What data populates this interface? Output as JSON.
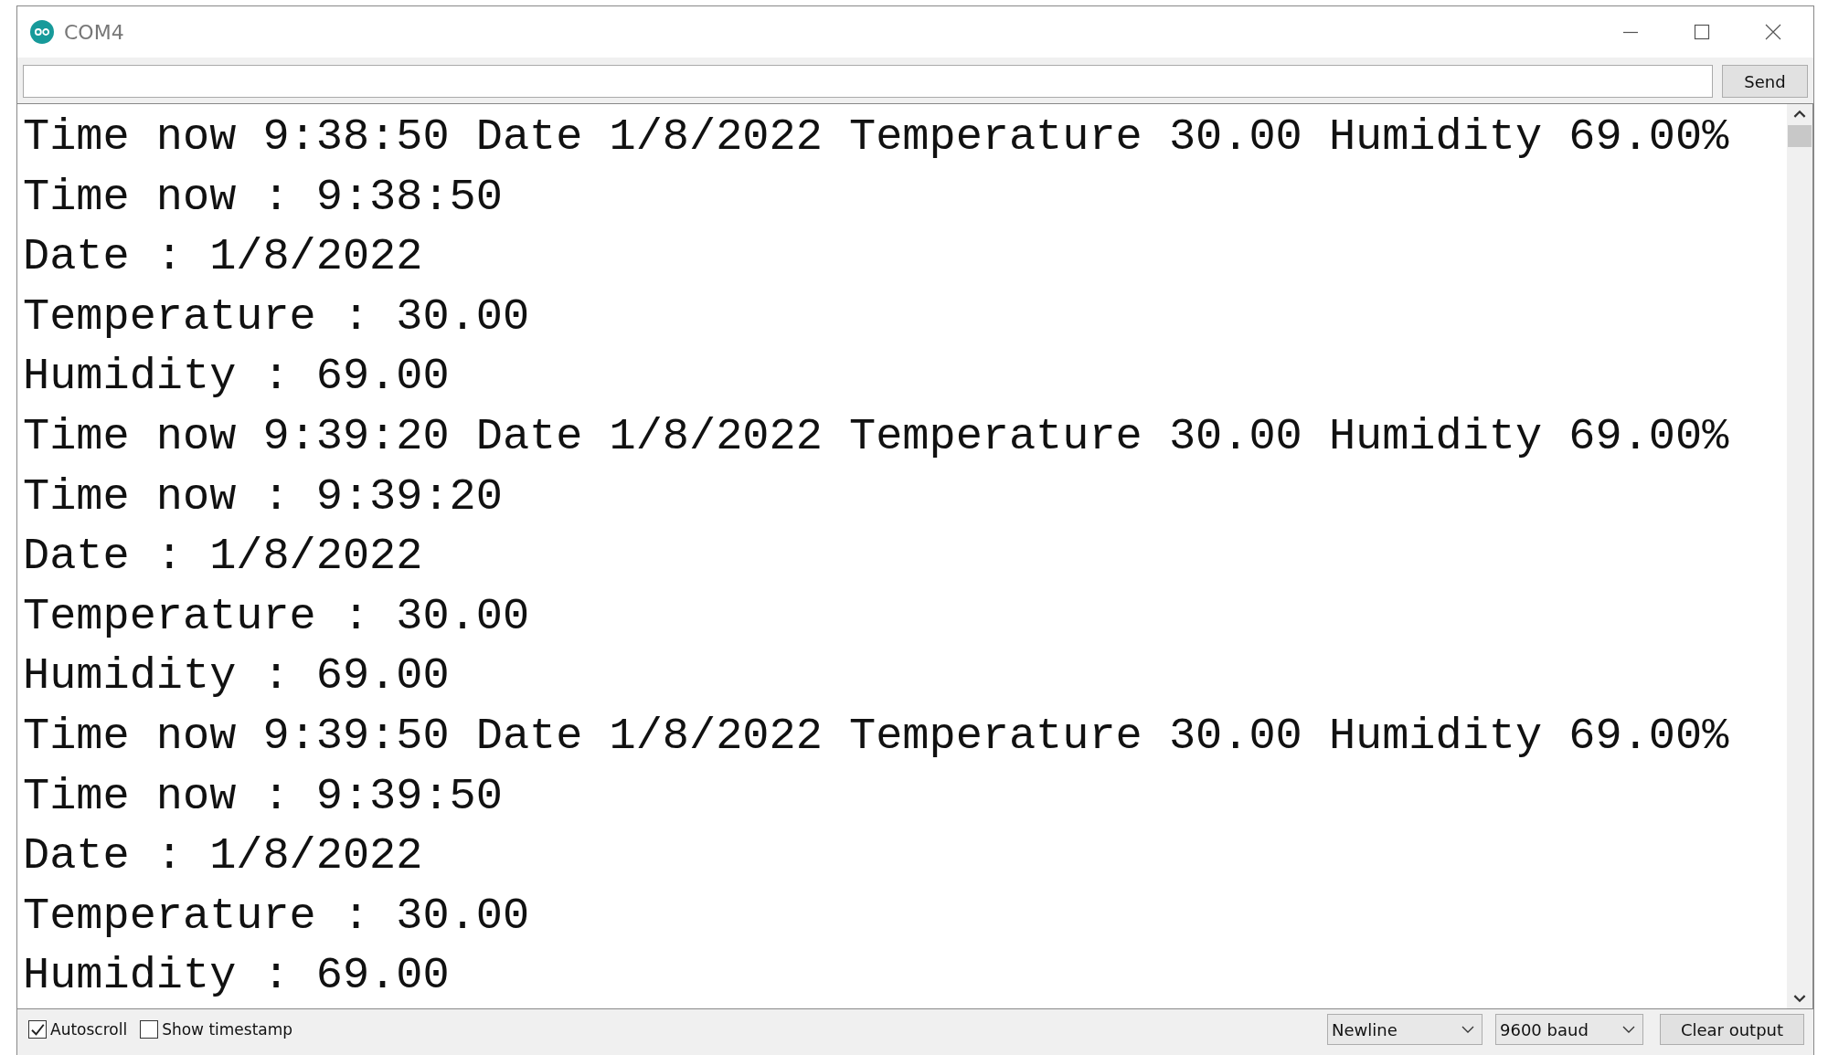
{
  "window": {
    "title": "COM4"
  },
  "input": {
    "button": "Send"
  },
  "output": {
    "lines": [
      "Time now 9:38:50 Date 1/8/2022 Temperature 30.00 Humidity 69.00%",
      "Time now : 9:38:50",
      "Date : 1/8/2022",
      "Temperature : 30.00",
      "Humidity : 69.00",
      "Time now 9:39:20 Date 1/8/2022 Temperature 30.00 Humidity 69.00%",
      "Time now : 9:39:20",
      "Date : 1/8/2022",
      "Temperature : 30.00",
      "Humidity : 69.00",
      "Time now 9:39:50 Date 1/8/2022 Temperature 30.00 Humidity 69.00%",
      "Time now : 9:39:50",
      "Date : 1/8/2022",
      "Temperature : 30.00",
      "Humidity : 69.00"
    ]
  },
  "footer": {
    "checkboxes": [
      {
        "label": "Autoscroll",
        "checked": true
      },
      {
        "label": "Show timestamp",
        "checked": false
      }
    ],
    "dropdowns": [
      {
        "value": "Newline"
      },
      {
        "value": "9600 baud"
      }
    ],
    "button": "Clear output"
  }
}
